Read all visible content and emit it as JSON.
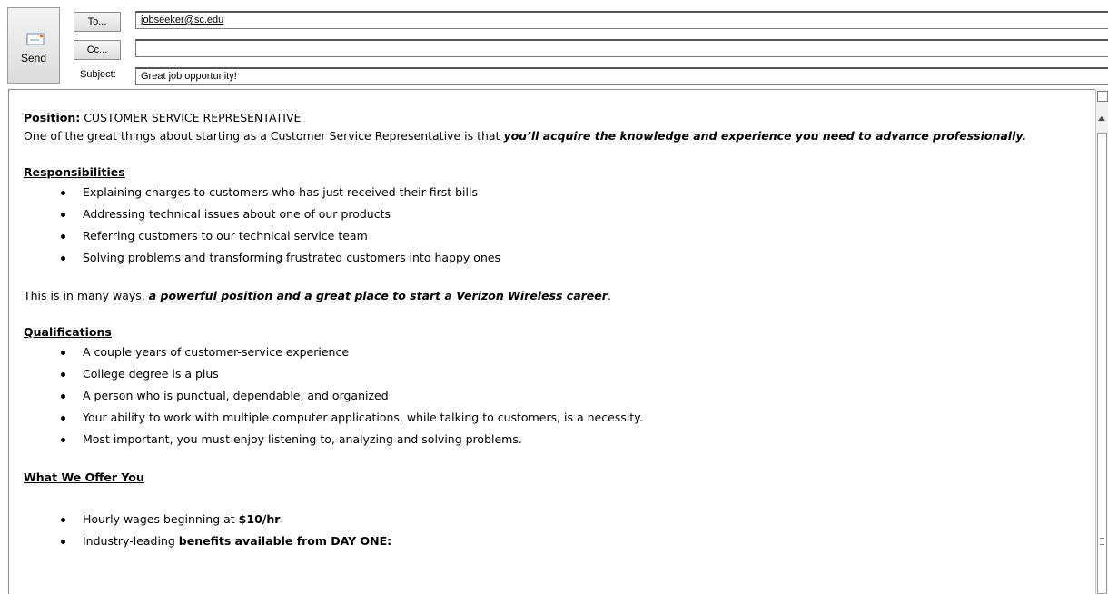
{
  "compose": {
    "send_label": "Send",
    "to_button": "To...",
    "cc_button": "Cc...",
    "subject_label": "Subject:",
    "to_value": "jobseeker@sc.edu",
    "cc_value": "",
    "subject_value": "Great job opportunity!"
  },
  "body": {
    "position_label": "Position:",
    "position_value": " CUSTOMER SERVICE REPRESENTATIVE",
    "intro_plain": "One of the great things about starting as a Customer Service Representative is that ",
    "intro_emph": "you’ll acquire the knowledge and experience you need to advance professionally.",
    "responsibilities_heading": "Responsibilities",
    "responsibilities": [
      "Explaining charges to customers who has just received their first bills",
      "Addressing technical issues about one of our products",
      "Referring customers to our technical service team",
      "Solving problems and transforming frustrated customers into happy ones"
    ],
    "summary_plain": "This is in many ways, ",
    "summary_emph": "a powerful position and a great place to start a Verizon Wireless career",
    "summary_end": ".",
    "qualifications_heading": "Qualifications",
    "qualifications": [
      "A couple years of customer-service experience",
      "College degree is a plus",
      "A person who is punctual, dependable, and organized",
      "Your ability to work with multiple computer applications, while talking to customers, is a necessity.",
      "Most important, you must enjoy listening to, analyzing and solving problems."
    ],
    "offer_heading": "What We Offer You",
    "offer_1_plain": "Hourly wages beginning at ",
    "offer_1_bold": "$10/hr",
    "offer_1_end": ".",
    "offer_2_plain": "Industry-leading ",
    "offer_2_bold": "benefits available from DAY ONE:"
  },
  "icons": {
    "send": "envelope-send-icon",
    "ruler": "ruler-toggle-icon"
  }
}
